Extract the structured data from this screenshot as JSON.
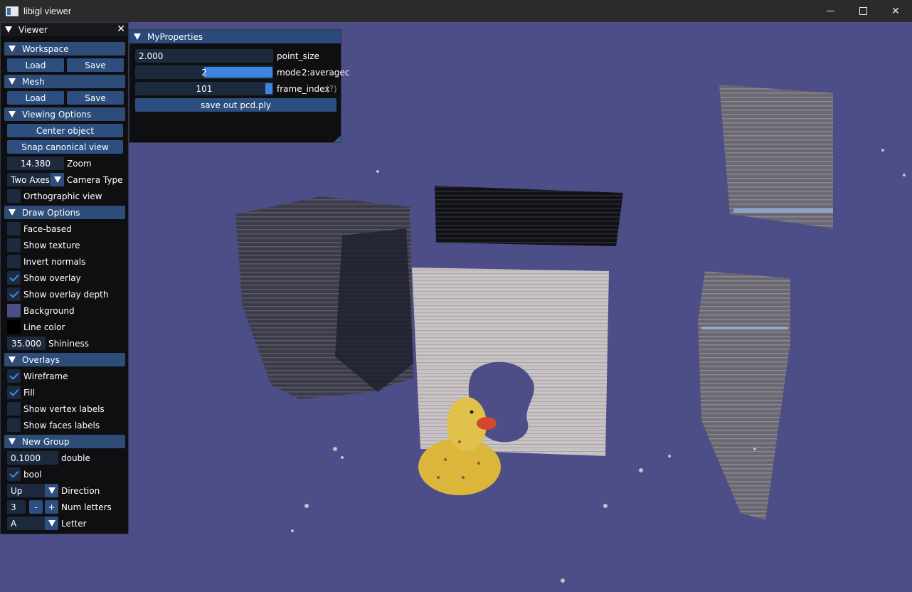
{
  "window": {
    "title": "libigl viewer",
    "controls": {
      "minimize": "—",
      "maximize": "☐",
      "close": "✕"
    }
  },
  "viewport": {
    "background_color": "#4d4d88",
    "content": "point cloud of a room with a rubber duck"
  },
  "viewer_panel": {
    "title": "Viewer",
    "close_icon": "✕",
    "workspace": {
      "header": "Workspace",
      "load_label": "Load",
      "save_label": "Save"
    },
    "mesh": {
      "header": "Mesh",
      "load_label": "Load",
      "save_label": "Save"
    },
    "viewing_options": {
      "header": "Viewing Options",
      "center_object_label": "Center object",
      "snap_view_label": "Snap canonical view",
      "zoom_value": "14.380",
      "zoom_label": "Zoom",
      "camera_type_value": "Two Axes",
      "camera_type_label": "Camera Type",
      "orthographic_label": "Orthographic view"
    },
    "draw_options": {
      "header": "Draw Options",
      "face_based_label": "Face-based",
      "show_texture_label": "Show texture",
      "invert_normals_label": "Invert normals",
      "show_overlay_label": "Show overlay",
      "show_overlay_depth_label": "Show overlay depth",
      "background_label": "Background",
      "background_color": "#4d4d88",
      "line_color_label": "Line color",
      "line_color": "#000000",
      "shininess_value": "35.000",
      "shininess_label": "Shininess"
    },
    "overlays": {
      "header": "Overlays",
      "wireframe_label": "Wireframe",
      "fill_label": "Fill",
      "show_vertex_labels_label": "Show vertex labels",
      "show_faces_labels_label": "Show faces labels"
    },
    "new_group": {
      "header": "New Group",
      "double_value": "0.1000",
      "double_label": "double",
      "bool_label": "bool",
      "direction_value": "Up",
      "direction_label": "Direction",
      "num_letters_value": "3",
      "minus_label": "-",
      "plus_label": "+",
      "num_letters_label": "Num letters",
      "letter_value": "A",
      "letter_label": "Letter"
    },
    "checks": {
      "orthographic": false,
      "face_based": false,
      "show_texture": false,
      "invert_normals": false,
      "show_overlay": true,
      "show_overlay_depth": true,
      "wireframe": true,
      "fill": true,
      "show_vertex_labels": false,
      "show_faces_labels": false,
      "bool": true
    }
  },
  "properties_panel": {
    "title": "MyProperties",
    "point_size_value": "2.000",
    "point_size_label": "point_size",
    "mode_value": "2",
    "mode_fraction": 0.5,
    "mode_label": "mode",
    "mode_text": "2:averagec",
    "frame_index_value": "101",
    "frame_index_label": "frame_index",
    "help_marker": "(?)",
    "save_button_label": "save out pcd.ply"
  },
  "accent_color": "#3d85e0"
}
